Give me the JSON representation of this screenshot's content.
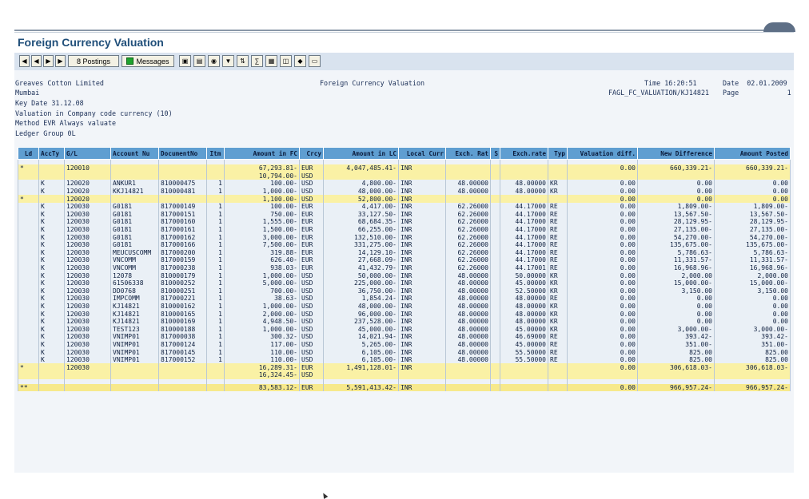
{
  "window": {
    "title": "Foreign Currency Valuation"
  },
  "toolbar": {
    "postings_label": "8 Postings",
    "messages_label": "Messages"
  },
  "header": {
    "company": "Greaves Cotton Limited",
    "city": "Mumbai",
    "key_date": "Key Date 31.12.08",
    "valuation": "Valuation in Company code currency (10)",
    "method": "Method EVR Always valuate",
    "ledger": "Ledger Group 0L",
    "report_title": "Foreign Currency Valuation",
    "time": "Time 16:20:51",
    "date": "Date  02.01.2009",
    "program": "FAGL_FC_VALUATION/KJ14821",
    "page": "Page            1"
  },
  "table": {
    "columns": [
      "Ld",
      "AccTy",
      "G/L",
      "Account Nu",
      "DocumentNo",
      "Itm",
      "Amount in FC",
      "Crcy",
      "Amount in LC",
      "Local Curr",
      "Exch. Rat",
      "S",
      "Exch.rate",
      "Typ",
      "Valuation diff.",
      "New Difference",
      "Amount Posted"
    ],
    "rows": [
      {
        "type": "sp",
        "cells": []
      },
      {
        "type": "sub",
        "cells": [
          "*",
          "",
          "120010",
          "",
          "",
          "",
          "67,293.81-",
          "EUR",
          "4,047,485.41-",
          "INR",
          "",
          "",
          "",
          "",
          "0.00",
          "660,339.21-",
          "660,339.21-"
        ]
      },
      {
        "type": "sub",
        "cells": [
          "",
          "",
          "",
          "",
          "",
          "",
          "10,794.00-",
          "USD",
          "",
          "",
          "",
          "",
          "",
          "",
          "",
          "",
          ""
        ]
      },
      {
        "type": "nrm",
        "cells": [
          "",
          "K",
          "120020",
          "ANKUR1",
          "810000475",
          "1",
          "100.00-",
          "USD",
          "4,800.00-",
          "INR",
          "48.00000",
          "",
          "48.00000",
          "KR",
          "0.00",
          "0.00",
          "0.00"
        ]
      },
      {
        "type": "nrm",
        "cells": [
          "",
          "K",
          "120020",
          "KKJ14821",
          "810000481",
          "1",
          "1,000.00-",
          "USD",
          "48,000.00-",
          "INR",
          "48.00000",
          "",
          "48.00000",
          "KR",
          "0.00",
          "0.00",
          "0.00"
        ]
      },
      {
        "type": "sub",
        "cells": [
          "*",
          "",
          "120020",
          "",
          "",
          "",
          "1,100.00-",
          "USD",
          "52,800.00-",
          "INR",
          "",
          "",
          "",
          "",
          "0.00",
          "0.00",
          "0.00"
        ]
      },
      {
        "type": "nrm",
        "cells": [
          "",
          "K",
          "120030",
          "G0181",
          "817000149",
          "1",
          "100.00-",
          "EUR",
          "4,417.00-",
          "INR",
          "62.26000",
          "",
          "44.17000",
          "RE",
          "0.00",
          "1,809.00-",
          "1,809.00-"
        ]
      },
      {
        "type": "nrm",
        "cells": [
          "",
          "K",
          "120030",
          "G0181",
          "817000151",
          "1",
          "750.00-",
          "EUR",
          "33,127.50-",
          "INR",
          "62.26000",
          "",
          "44.17000",
          "RE",
          "0.00",
          "13,567.50-",
          "13,567.50-"
        ]
      },
      {
        "type": "nrm",
        "cells": [
          "",
          "K",
          "120030",
          "G0181",
          "817000160",
          "1",
          "1,555.00-",
          "EUR",
          "68,684.35-",
          "INR",
          "62.26000",
          "",
          "44.17000",
          "RE",
          "0.00",
          "28,129.95-",
          "28,129.95-"
        ]
      },
      {
        "type": "nrm",
        "cells": [
          "",
          "K",
          "120030",
          "G0181",
          "817000161",
          "1",
          "1,500.00-",
          "EUR",
          "66,255.00-",
          "INR",
          "62.26000",
          "",
          "44.17000",
          "RE",
          "0.00",
          "27,135.00-",
          "27,135.00-"
        ]
      },
      {
        "type": "nrm",
        "cells": [
          "",
          "K",
          "120030",
          "G0181",
          "817000162",
          "1",
          "3,000.00-",
          "EUR",
          "132,510.00-",
          "INR",
          "62.26000",
          "",
          "44.17000",
          "RE",
          "0.00",
          "54,270.00-",
          "54,270.00-"
        ]
      },
      {
        "type": "nrm",
        "cells": [
          "",
          "K",
          "120030",
          "G0181",
          "817000166",
          "1",
          "7,500.00-",
          "EUR",
          "331,275.00-",
          "INR",
          "62.26000",
          "",
          "44.17000",
          "RE",
          "0.00",
          "135,675.00-",
          "135,675.00-"
        ]
      },
      {
        "type": "nrm",
        "cells": [
          "",
          "K",
          "120030",
          "MEUCUSCOMM",
          "817000200",
          "1",
          "319.88-",
          "EUR",
          "14,129.10-",
          "INR",
          "62.26000",
          "",
          "44.17000",
          "RE",
          "0.00",
          "5,786.63-",
          "5,786.63-"
        ]
      },
      {
        "type": "nrm",
        "cells": [
          "",
          "K",
          "120030",
          "VNCOMM",
          "817000159",
          "1",
          "626.40-",
          "EUR",
          "27,668.09-",
          "INR",
          "62.26000",
          "",
          "44.17000",
          "RE",
          "0.00",
          "11,331.57-",
          "11,331.57-"
        ]
      },
      {
        "type": "nrm",
        "cells": [
          "",
          "K",
          "120030",
          "VNCOMM",
          "817000238",
          "1",
          "938.03-",
          "EUR",
          "41,432.79-",
          "INR",
          "62.26000",
          "",
          "44.17001",
          "RE",
          "0.00",
          "16,968.96-",
          "16,968.96-"
        ]
      },
      {
        "type": "nrm",
        "cells": [
          "",
          "K",
          "120030",
          "12078",
          "810000179",
          "1",
          "1,000.00-",
          "USD",
          "50,000.00-",
          "INR",
          "48.00000",
          "",
          "50.00000",
          "KR",
          "0.00",
          "2,000.00",
          "2,000.00"
        ]
      },
      {
        "type": "nrm",
        "cells": [
          "",
          "K",
          "120030",
          "61506338",
          "810000252",
          "1",
          "5,000.00-",
          "USD",
          "225,000.00-",
          "INR",
          "48.00000",
          "",
          "45.00000",
          "KR",
          "0.00",
          "15,000.00-",
          "15,000.00-"
        ]
      },
      {
        "type": "nrm",
        "cells": [
          "",
          "K",
          "120030",
          "DD0768",
          "810000251",
          "1",
          "700.00-",
          "USD",
          "36,750.00-",
          "INR",
          "48.00000",
          "",
          "52.50000",
          "KR",
          "0.00",
          "3,150.00",
          "3,150.00"
        ]
      },
      {
        "type": "nrm",
        "cells": [
          "",
          "K",
          "120030",
          "IMPCOMM",
          "817000221",
          "1",
          "38.63-",
          "USD",
          "1,854.24-",
          "INR",
          "48.00000",
          "",
          "48.00000",
          "RE",
          "0.00",
          "0.00",
          "0.00"
        ]
      },
      {
        "type": "nrm",
        "cells": [
          "",
          "K",
          "120030",
          "KJ14821",
          "810000162",
          "1",
          "1,000.00-",
          "USD",
          "48,000.00-",
          "INR",
          "48.00000",
          "",
          "48.00000",
          "KR",
          "0.00",
          "0.00",
          "0.00"
        ]
      },
      {
        "type": "nrm",
        "cells": [
          "",
          "K",
          "120030",
          "KJ14821",
          "810000165",
          "1",
          "2,000.00-",
          "USD",
          "96,000.00-",
          "INR",
          "48.00000",
          "",
          "48.00000",
          "KR",
          "0.00",
          "0.00",
          "0.00"
        ]
      },
      {
        "type": "nrm",
        "cells": [
          "",
          "K",
          "120030",
          "KJ14821",
          "810000169",
          "1",
          "4,948.50-",
          "USD",
          "237,528.00-",
          "INR",
          "48.00000",
          "",
          "48.00000",
          "KR",
          "0.00",
          "0.00",
          "0.00"
        ]
      },
      {
        "type": "nrm",
        "cells": [
          "",
          "K",
          "120030",
          "TEST123",
          "810000188",
          "1",
          "1,000.00-",
          "USD",
          "45,000.00-",
          "INR",
          "48.00000",
          "",
          "45.00000",
          "KR",
          "0.00",
          "3,000.00-",
          "3,000.00-"
        ]
      },
      {
        "type": "nrm",
        "cells": [
          "",
          "K",
          "120030",
          "VNIMP01",
          "817000038",
          "1",
          "300.32-",
          "USD",
          "14,021.94-",
          "INR",
          "48.00000",
          "",
          "46.69000",
          "RE",
          "0.00",
          "393.42-",
          "393.42-"
        ]
      },
      {
        "type": "nrm",
        "cells": [
          "",
          "K",
          "120030",
          "VNIMP01",
          "817000124",
          "1",
          "117.00-",
          "USD",
          "5,265.00-",
          "INR",
          "48.00000",
          "",
          "45.00000",
          "RE",
          "0.00",
          "351.00-",
          "351.00-"
        ]
      },
      {
        "type": "nrm",
        "cells": [
          "",
          "K",
          "120030",
          "VNIMP01",
          "817000145",
          "1",
          "110.00-",
          "USD",
          "6,105.00-",
          "INR",
          "48.00000",
          "",
          "55.50000",
          "RE",
          "0.00",
          "825.00",
          "825.00"
        ]
      },
      {
        "type": "nrm",
        "cells": [
          "",
          "K",
          "120030",
          "VNIMP01",
          "817000152",
          "1",
          "110.00-",
          "USD",
          "6,105.00-",
          "INR",
          "48.00000",
          "",
          "55.50000",
          "RE",
          "0.00",
          "825.00",
          "825.00"
        ]
      },
      {
        "type": "sub",
        "cells": [
          "*",
          "",
          "120030",
          "",
          "",
          "",
          "16,289.31-",
          "EUR",
          "1,491,128.01-",
          "INR",
          "",
          "",
          "",
          "",
          "0.00",
          "306,618.03-",
          "306,618.03-"
        ]
      },
      {
        "type": "sub",
        "cells": [
          "",
          "",
          "",
          "",
          "",
          "",
          "16,324.45-",
          "USD",
          "",
          "",
          "",
          "",
          "",
          "",
          "",
          "",
          ""
        ]
      },
      {
        "type": "sp",
        "cells": []
      },
      {
        "type": "tot",
        "cells": [
          "**",
          "",
          "",
          "",
          "",
          "",
          "83,583.12-",
          "EUR",
          "5,591,413.42-",
          "INR",
          "",
          "",
          "",
          "",
          "0.00",
          "966,957.24-",
          "966,957.24-"
        ]
      }
    ]
  }
}
